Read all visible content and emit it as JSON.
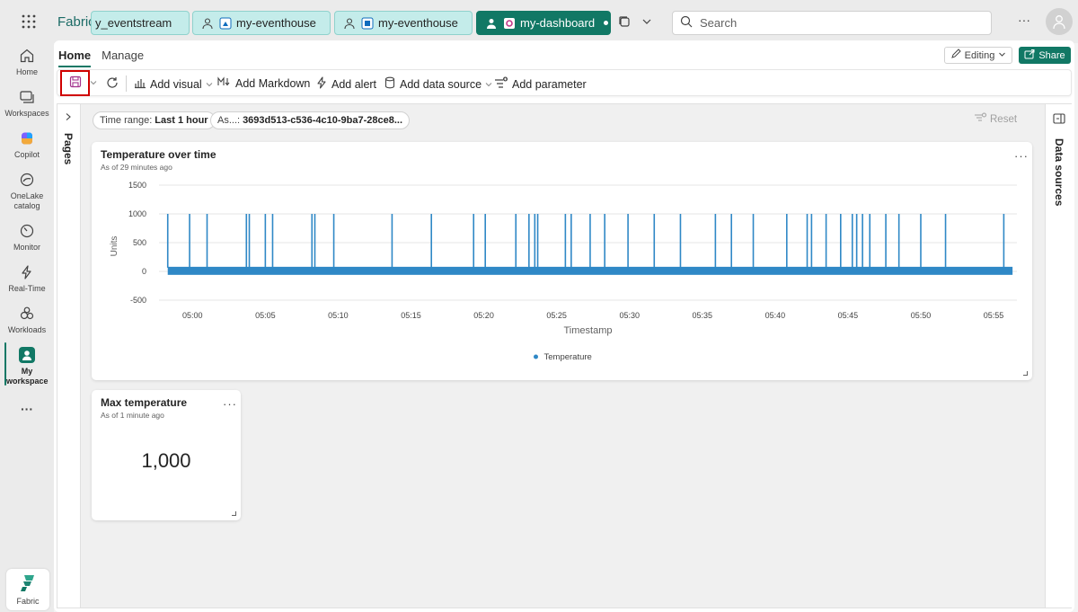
{
  "header": {
    "brand": "Fabric",
    "tabs": [
      {
        "label": "y_eventstream"
      },
      {
        "label": "my-eventhouse"
      },
      {
        "label": "my-eventhouse"
      },
      {
        "label": "my-dashboard"
      }
    ],
    "search_placeholder": "Search",
    "more_label": "···"
  },
  "leftnav": {
    "items": [
      {
        "label": "Home"
      },
      {
        "label": "Workspaces"
      },
      {
        "label": "Copilot"
      },
      {
        "label": "OneLake catalog"
      },
      {
        "label": "Monitor"
      },
      {
        "label": "Real-Time"
      },
      {
        "label": "Workloads"
      },
      {
        "label": "My workspace"
      }
    ],
    "more": "···",
    "fabric_label": "Fabric"
  },
  "ribbon": {
    "tabs": [
      "Home",
      "Manage"
    ],
    "editing_label": "Editing",
    "share_label": "Share"
  },
  "toolbar": {
    "add_visual": "Add visual",
    "add_markdown": "Add Markdown",
    "add_alert": "Add alert",
    "add_data_source": "Add data source",
    "add_parameter": "Add parameter"
  },
  "filters": {
    "time_range_label": "Time range:",
    "time_range_value": "Last 1 hour",
    "as_label": "As...:",
    "as_value": "3693d513-c536-4c10-9ba7-28ce8...",
    "reset_label": "Reset"
  },
  "side_labels": {
    "pages": "Pages",
    "data_sources": "Data sources"
  },
  "tiles": {
    "temperature": {
      "title": "Temperature over time",
      "subtitle": "As of 29 minutes ago"
    },
    "max_temp": {
      "title": "Max temperature",
      "subtitle": "As of 1 minute ago",
      "value": "1,000"
    }
  },
  "chart_data": {
    "type": "line",
    "title": "Temperature over time",
    "xlabel": "Timestamp",
    "ylabel": "Units",
    "ylim": [
      -500,
      1500
    ],
    "yticks": [
      1500,
      1000,
      500,
      0,
      -500
    ],
    "xticks": [
      "05:00",
      "05:05",
      "05:10",
      "05:15",
      "05:20",
      "05:25",
      "05:30",
      "05:35",
      "05:40",
      "05:45",
      "05:50",
      "05:55"
    ],
    "xrange_minutes": [
      -2.3,
      56.6
    ],
    "baseline_band": [
      -60,
      80
    ],
    "spike_value": 1000,
    "spike_minutes": [
      -1.7,
      -0.2,
      1.0,
      3.7,
      3.9,
      5.0,
      5.5,
      8.2,
      8.4,
      9.7,
      13.7,
      16.4,
      19.3,
      20.1,
      22.2,
      23.1,
      23.5,
      23.7,
      25.6,
      26.0,
      27.3,
      28.3,
      29.9,
      31.7,
      33.5,
      35.9,
      37.0,
      38.5,
      40.8,
      42.2,
      42.5,
      43.5,
      44.5,
      45.3,
      45.6,
      46.0,
      46.5,
      47.6,
      48.5,
      50.0,
      51.7,
      55.7
    ],
    "grid": true,
    "legend_position": "bottom",
    "series": [
      {
        "name": "Temperature",
        "color": "#2f88c6"
      }
    ]
  },
  "colors": {
    "accent": "#117865",
    "series": "#2f88c6",
    "save_highlight": "#d00000"
  }
}
